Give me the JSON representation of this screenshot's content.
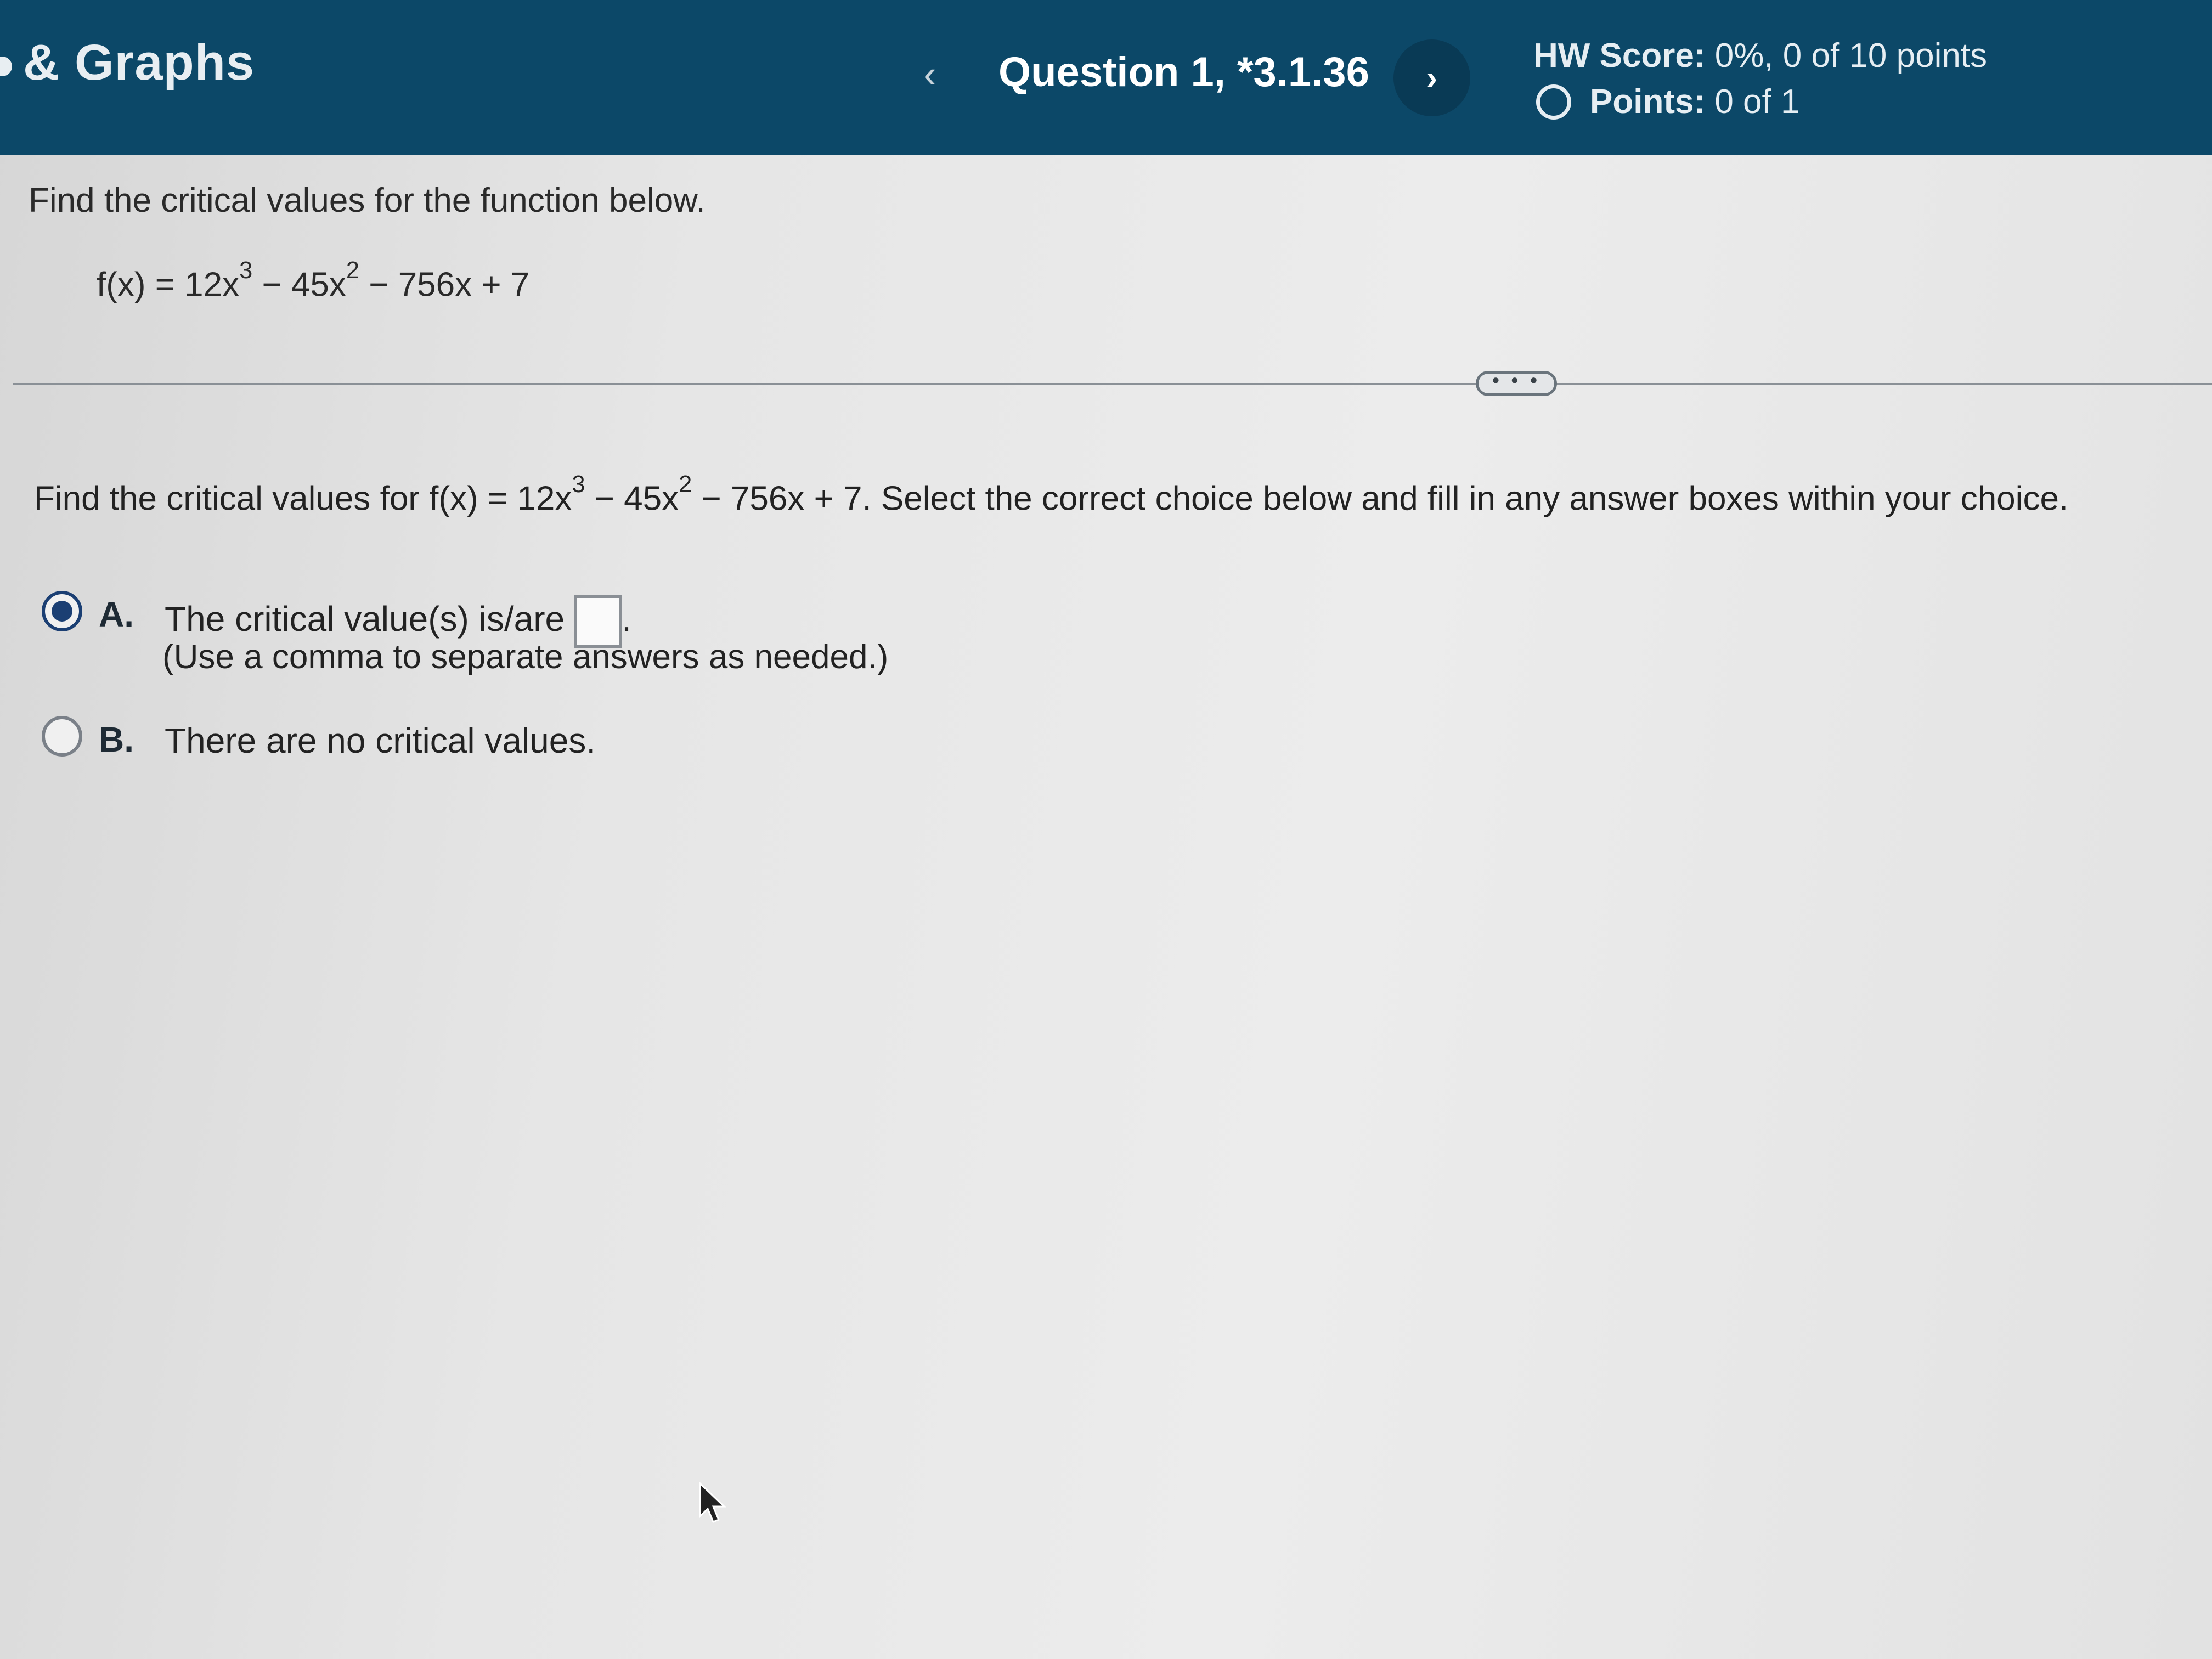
{
  "header": {
    "course_title": "& Graphs",
    "question_label": "Question 1, *3.1.36",
    "prev_glyph": "‹",
    "next_glyph": "›",
    "hw_score_label": "HW Score:",
    "hw_score_value": "0%, 0 of 10 points",
    "points_label": "Points:",
    "points_value": "0 of 1"
  },
  "problem": {
    "prompt": "Find the critical values for the function below.",
    "function_prefix": "f(x) = 12x",
    "exp1": "3",
    "mid1": " − 45x",
    "exp2": "2",
    "tail": " − 756x + 7",
    "more_label": "• • •"
  },
  "question": {
    "instruction_prefix": "Find the critical values for f(x) = 12x",
    "exp1": "3",
    "mid1": " − 45x",
    "exp2": "2",
    "instruction_suffix": " − 756x + 7. Select the correct choice below and fill in any answer boxes within your choice.",
    "choices": [
      {
        "letter": "A.",
        "text": "The critical value(s) is/are",
        "after_box": ".",
        "hint": "(Use a comma to separate answers as needed.)",
        "selected": true
      },
      {
        "letter": "B.",
        "text": "There are no critical values.",
        "selected": false
      }
    ]
  },
  "colors": {
    "header_bg": "#0c4868",
    "radio_selected": "#1b3f73"
  }
}
